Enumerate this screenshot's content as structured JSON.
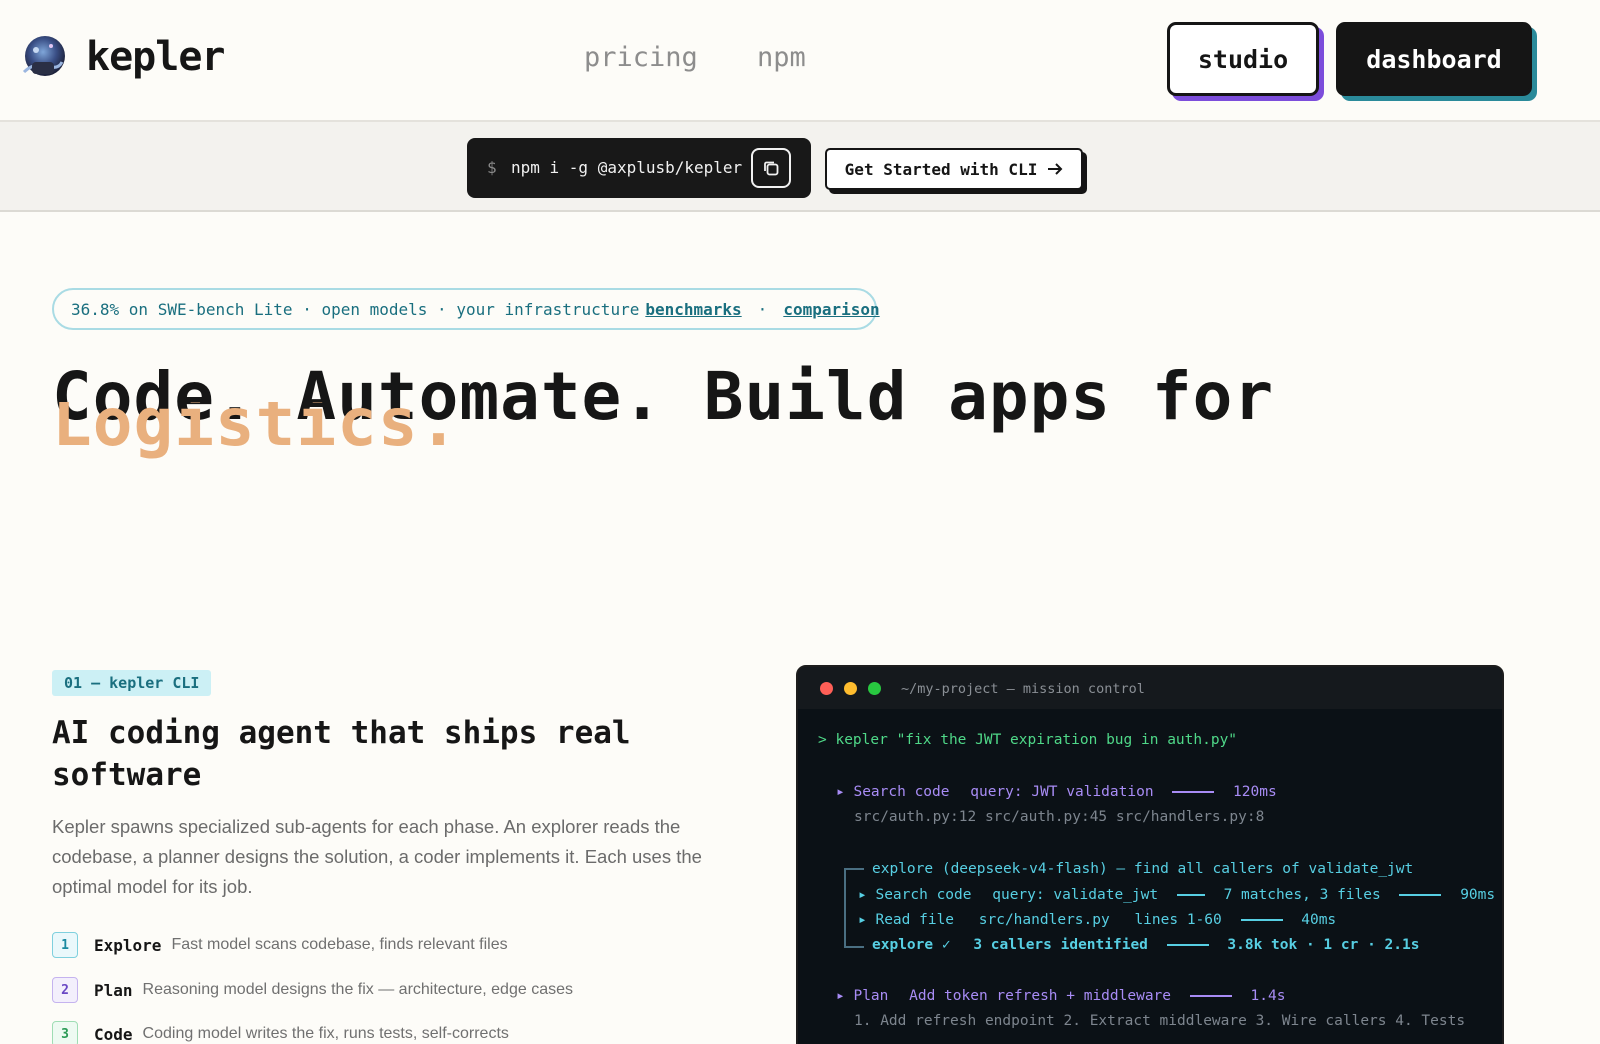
{
  "header": {
    "brand": "kepler",
    "nav": [
      "pricing",
      "npm"
    ],
    "studio_label": "studio",
    "dashboard_label": "dashboard",
    "colors": {
      "studio_shadow": "#7c4ddb",
      "dashboard_shadow": "#2a8a9a"
    }
  },
  "cli_strip": {
    "prompt": "$",
    "command": "npm i -g @axplusb/kepler",
    "cta_label": "Get Started with CLI"
  },
  "hero": {
    "pill": {
      "text": "36.8% on SWE-bench Lite · open models · your infrastructure",
      "link1": "benchmarks",
      "sep": "·",
      "link2": "comparison"
    },
    "headline": "Code. Automate. Build apps for",
    "headline_accent": "Logistics.",
    "accent_color": "#e9b07e"
  },
  "feature": {
    "tag": "01 — kepler CLI",
    "title": "AI coding agent that ships real software",
    "description": "Kepler spawns specialized sub-agents for each phase. An explorer reads the codebase, a planner designs the solution, a coder implements it. Each uses the optimal model for its job.",
    "steps": [
      {
        "num": "1",
        "name": "Explore",
        "desc": "Fast model scans codebase, finds relevant files"
      },
      {
        "num": "2",
        "name": "Plan",
        "desc": "Reasoning model designs the fix — architecture, edge cases"
      },
      {
        "num": "3",
        "name": "Code",
        "desc": "Coding model writes the fix, runs tests, self-corrects"
      }
    ]
  },
  "terminal": {
    "title": "~/my-project — mission control",
    "prompt_line": "> kepler \"fix the JWT expiration bug in auth.py\"",
    "search": {
      "label": "▸ Search code",
      "query": "query: JWT validation",
      "time": "120ms"
    },
    "search_results": "src/auth.py:12   src/auth.py:45   src/handlers.py:8",
    "explore_header": "explore (deepseek-v4-flash) — find all callers of validate_jwt",
    "explore_search": {
      "label": "▸ Search code",
      "query": "query: validate_jwt",
      "result": "7 matches, 3 files",
      "time": "90ms"
    },
    "explore_read": {
      "label": "▸ Read file",
      "file": "src/handlers.py",
      "lines": "lines 1-60",
      "time": "40ms"
    },
    "explore_done": {
      "label": "explore ✓",
      "result": "3 callers identified",
      "stats": "3.8k tok · 1 cr · 2.1s"
    },
    "plan": {
      "label": "▸ Plan",
      "text": "Add token refresh + middleware",
      "time": "1.4s"
    },
    "plan_steps": "1. Add refresh endpoint   2. Extract middleware   3. Wire callers   4. Tests"
  }
}
